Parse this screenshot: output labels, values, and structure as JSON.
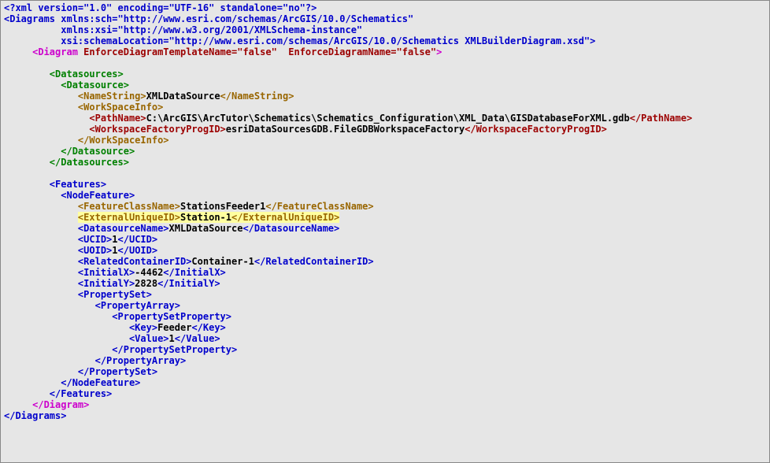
{
  "xmlDecl": "<?xml version=\"1.0\" encoding=\"UTF-16\" standalone=\"no\"?>",
  "rootOpen1": "<Diagrams xmlns:sch=\"http://www.esri.com/schemas/ArcGIS/10.0/Schematics\"",
  "rootOpen2": "xmlns:xsi=\"http://www.w3.org/2001/XMLSchema-instance\"",
  "rootOpen3": "xsi:schemaLocation=\"http://www.esri.com/schemas/ArcGIS/10.0/Schematics XMLBuilderDiagram.xsd\">",
  "diagramOpen1": "<Diagram",
  "diagramAttr1": "EnforceDiagramTemplateName=\"false\"",
  "diagramAttr2": "EnforceDiagramName=\"false\"",
  "datasourcesOpen": "<Datasources>",
  "datasourceOpen": "<Datasource>",
  "nameStringOpen": "<NameString>",
  "nameStringVal": "XMLDataSource",
  "nameStringClose": "</NameString>",
  "workSpaceInfoOpen": "<WorkSpaceInfo>",
  "pathNameOpen": "<PathName>",
  "pathNameVal": "C:\\ArcGIS\\ArcTutor\\Schematics\\Schematics_Configuration\\XML_Data\\GISDatabaseForXML.gdb",
  "pathNameClose": "</PathName>",
  "wfpOpen": "<WorkspaceFactoryProgID>",
  "wfpVal": "esriDataSourcesGDB.FileGDBWorkspaceFactory",
  "wfpClose": "</WorkspaceFactoryProgID>",
  "workSpaceInfoClose": "</WorkSpaceInfo>",
  "datasourceClose": "</Datasource>",
  "datasourcesClose": "</Datasources>",
  "featuresOpen": "<Features>",
  "nodeFeatureOpen": "<NodeFeature>",
  "fcnOpen": "<FeatureClassName>",
  "fcnVal": "StationsFeeder1",
  "fcnClose": "</FeatureClassName>",
  "euidOpen": "<ExternalUniqueID>",
  "euidVal": "Station-1",
  "euidClose": "</ExternalUniqueID>",
  "dsnOpen": "<DatasourceName>",
  "dsnVal": "XMLDataSource",
  "dsnClose": "</DatasourceName>",
  "ucidOpen": "<UCID>",
  "ucidVal": "1",
  "ucidClose": "</UCID>",
  "uoidOpen": "<UOID>",
  "uoidVal": "1",
  "uoidClose": "</UOID>",
  "rcidOpen": "<RelatedContainerID>",
  "rcidVal": "Container-1",
  "rcidClose": "</RelatedContainerID>",
  "ixOpen": "<InitialX>",
  "ixVal": "-4462",
  "ixClose": "</InitialX>",
  "iyOpen": "<InitialY>",
  "iyVal": "2828",
  "iyClose": "</InitialY>",
  "psOpen": "<PropertySet>",
  "paOpen": "<PropertyArray>",
  "pspOpen": "<PropertySetProperty>",
  "keyOpen": "<Key>",
  "keyVal": "Feeder",
  "keyClose": "</Key>",
  "valOpen": "<Value>",
  "valVal": "1",
  "valClose": "</Value>",
  "pspClose": "</PropertySetProperty>",
  "paClose": "</PropertyArray>",
  "psClose": "</PropertySet>",
  "nodeFeatureClose": "</NodeFeature>",
  "featuresClose": "</Features>",
  "diagramClose": "</Diagram>",
  "rootClose": "</Diagrams>"
}
